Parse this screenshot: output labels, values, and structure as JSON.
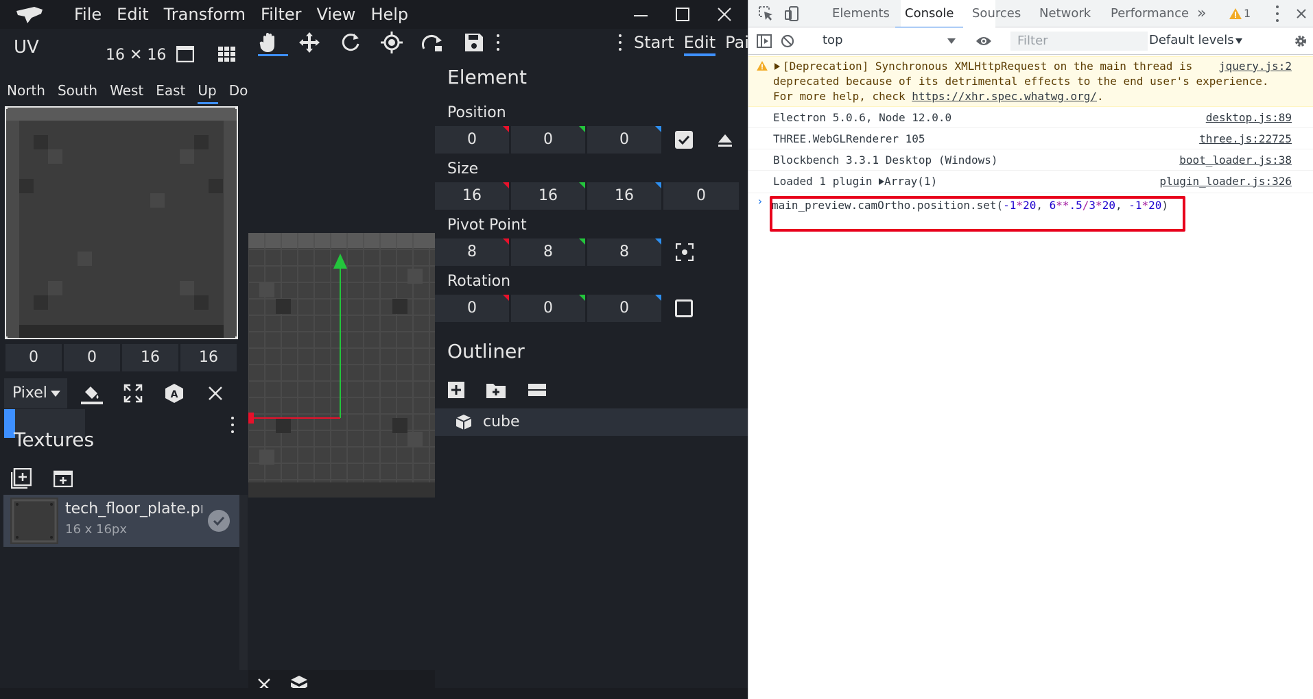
{
  "menu": [
    "File",
    "Edit",
    "Transform",
    "Filter",
    "View",
    "Help"
  ],
  "uv": {
    "title": "UV",
    "size": "16 ✕ 16",
    "faces": [
      "North",
      "South",
      "West",
      "East",
      "Up",
      "Down"
    ],
    "active_face": "Up",
    "coords": [
      "0",
      "0",
      "16",
      "16"
    ],
    "mode": "Pixel"
  },
  "modes": [
    "Start",
    "Edit",
    "Pai"
  ],
  "active_mode": "Edit",
  "element": {
    "title": "Element",
    "position_label": "Position",
    "position": [
      "0",
      "0",
      "0"
    ],
    "size_label": "Size",
    "size": [
      "16",
      "16",
      "16",
      "0"
    ],
    "pivot_label": "Pivot Point",
    "pivot": [
      "8",
      "8",
      "8"
    ],
    "rotation_label": "Rotation",
    "rotation": [
      "0",
      "0",
      "0"
    ]
  },
  "outliner": {
    "title": "Outliner",
    "items": [
      {
        "name": "cube"
      }
    ]
  },
  "textures": {
    "title": "Textures",
    "items": [
      {
        "name": "tech_floor_plate.png",
        "dims": "16 x 16px"
      }
    ]
  },
  "devtools": {
    "tabs": [
      "Elements",
      "Console",
      "Sources",
      "Network",
      "Performance"
    ],
    "active_tab": "Console",
    "more": "»",
    "warning_count": "1",
    "context": "top",
    "filter_placeholder": "Filter",
    "levels": "Default levels",
    "warning": {
      "line1": "[Deprecation] Synchronous XMLHttpRequest on the main thread is",
      "line2": "deprecated because of its detrimental effects to the end user's experience.",
      "line3_prefix": "For more help, check ",
      "line3_link": "https://xhr.spec.whatwg.org/",
      "line3_suffix": ".",
      "source": "jquery.js:2"
    },
    "messages": [
      {
        "text": "Electron 5.0.6, Node 12.0.0",
        "source": "desktop.js:89"
      },
      {
        "text": "THREE.WebGLRenderer 105",
        "source": "three.js:22725"
      },
      {
        "text": "Blockbench 3.3.1 Desktop (Windows)",
        "source": "boot_loader.js:38"
      },
      {
        "text": "Loaded 1 plugin",
        "extra": "Array(1)",
        "source": "plugin_loader.js:326"
      }
    ],
    "command": {
      "prefix": "main_preview.camOrtho.position.set(",
      "a1": "-1",
      "a2": "*",
      "a3": "20",
      "sep1": ", ",
      "b1": "6",
      "b2": "**",
      "b3": ".5",
      "b4": "/",
      "b5": "3",
      "b6": "*",
      "b7": "20",
      "sep2": ", ",
      "c1": "-1",
      "c2": "*",
      "c3": "20",
      "suffix": ")"
    }
  },
  "colors": {
    "accent": "#3e90ff",
    "x_axis": "#e8112b",
    "y_axis": "#23c53c",
    "z_axis": "#2d8ff0",
    "highlight": "#e8001c"
  }
}
